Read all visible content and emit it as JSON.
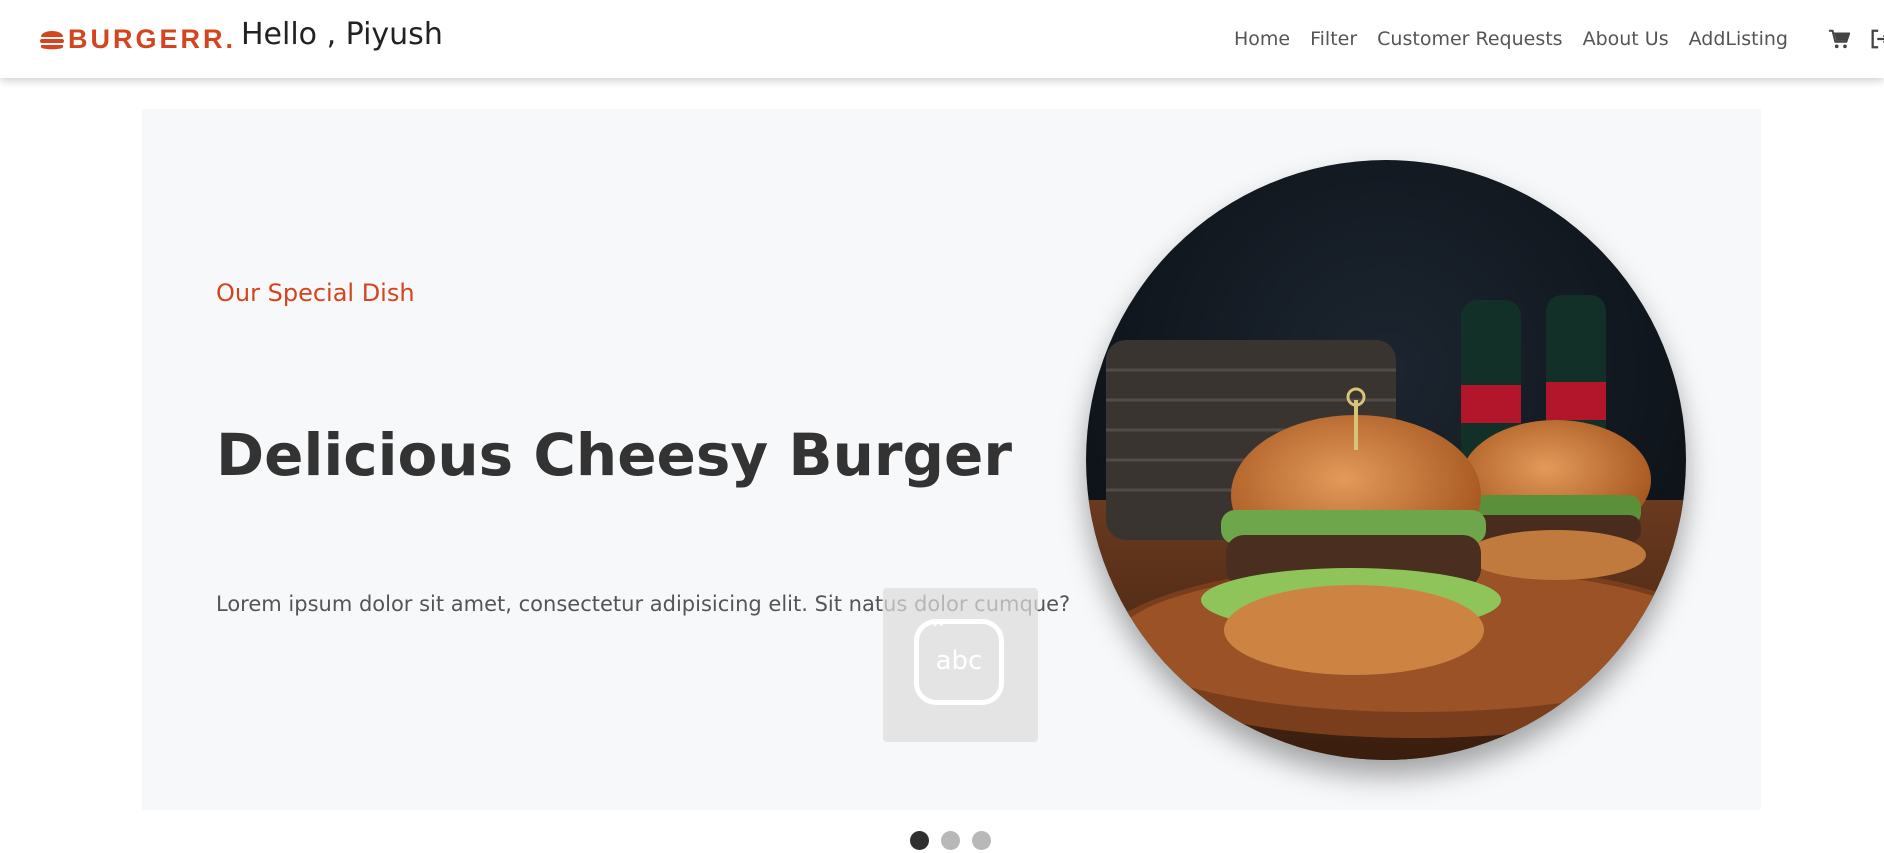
{
  "brand": {
    "name": "BURGERR.",
    "icon": "burger-icon",
    "color": "#d5441d"
  },
  "greeting": "Hello , Piyush",
  "nav": {
    "links": [
      {
        "label": "Home"
      },
      {
        "label": "Filter"
      },
      {
        "label": "Customer Requests"
      },
      {
        "label": "About Us"
      },
      {
        "label": "AddListing"
      }
    ],
    "icons": [
      "cart-icon",
      "logout-icon"
    ]
  },
  "hero": {
    "subtitle": "Our Special Dish",
    "title": "Delicious Cheesy Burger",
    "description": "Lorem ipsum dolor sit amet, consectetur adipisicing elit. Sit natus dolor cumque?",
    "image": "burger-photo",
    "background": "#f7f8fa"
  },
  "keyboard_overlay": {
    "text": "abc"
  },
  "carousel": {
    "slides": 3,
    "active": 1
  },
  "colors": {
    "accent": "#d5441d",
    "text": "#333333",
    "muted": "#555555"
  }
}
